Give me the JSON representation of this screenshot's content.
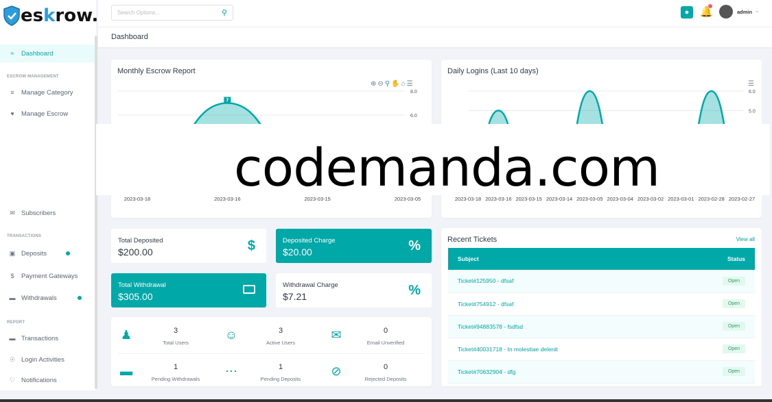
{
  "brand": {
    "pre": "es",
    "mid": "k",
    "post": "row."
  },
  "search": {
    "placeholder": "Search Options..."
  },
  "user": {
    "name": "admin"
  },
  "breadcrumb": "Dashboard",
  "sidebar": {
    "items": [
      {
        "label": "Dashboard",
        "icon": "chart-icon",
        "active": true
      },
      {
        "section": "ESCROW MANAGEMENT"
      },
      {
        "label": "Manage Category",
        "icon": "list-icon"
      },
      {
        "label": "Manage Escrow",
        "icon": "handshake-icon"
      },
      {
        "label": "Subscribers",
        "icon": "mail-icon"
      },
      {
        "section": "TRANSACTIONS"
      },
      {
        "label": "Deposits",
        "icon": "wallet-icon",
        "dot": true
      },
      {
        "label": "Payment Gateways",
        "icon": "dollar-icon"
      },
      {
        "label": "Withdrawals",
        "icon": "card-icon",
        "dot": true
      },
      {
        "section": "REPORT"
      },
      {
        "label": "Transactions",
        "icon": "card-icon"
      },
      {
        "label": "Login Activities",
        "icon": "login-icon"
      },
      {
        "label": "Notifications",
        "icon": "bell-icon"
      }
    ]
  },
  "chart_data": [
    {
      "type": "area",
      "title": "Monthly Escrow Report",
      "categories": [
        "2023-03-18",
        "2023-03-16",
        "2023-03-15",
        "2023-03-05"
      ],
      "values": [
        0,
        7,
        0,
        0
      ],
      "data_labels": [
        "7"
      ],
      "ylim": [
        0,
        8
      ],
      "yticks": [
        "8.0",
        "6.0"
      ],
      "grid": true,
      "color": "#00a9a8"
    },
    {
      "type": "area",
      "title": "Daily Logins (Last 10 days)",
      "categories": [
        "2023-03-18",
        "2023-03-16",
        "2023-03-15",
        "2023-03-14",
        "2023-03-05",
        "2023-03-04",
        "2023-03-02",
        "2023-03-01",
        "2023-02-28",
        "2023-02-27"
      ],
      "values": [
        1,
        5,
        1,
        1,
        6,
        1,
        1,
        1,
        6,
        1
      ],
      "ylim": [
        1,
        6
      ],
      "yticks": [
        "6.0",
        "5.0"
      ],
      "grid": true,
      "color": "#00a9a8"
    }
  ],
  "stats": [
    {
      "label": "Total Deposited",
      "value": "$200.00",
      "icon": "hand-dollar-icon"
    },
    {
      "label": "Deposited Charge",
      "value": "$20.00",
      "icon": "percent-icon"
    },
    {
      "label": "Total Withdrawal",
      "value": "$305.00",
      "icon": "card-icon"
    },
    {
      "label": "Withdrawal Charge",
      "value": "$7.21",
      "icon": "percent-icon"
    }
  ],
  "counts": [
    {
      "n": "3",
      "label": "Total Users",
      "icon": "users-icon"
    },
    {
      "n": "3",
      "label": "Active Users",
      "icon": "user-check-icon"
    },
    {
      "n": "0",
      "label": "Email Unverified",
      "icon": "envelope-icon"
    },
    {
      "n": "1",
      "label": "Pending Withdrawals",
      "icon": "card-icon"
    },
    {
      "n": "1",
      "label": "Pending Deposits",
      "icon": "spinner-icon"
    },
    {
      "n": "0",
      "label": "Rejected Deposits",
      "icon": "ban-icon"
    }
  ],
  "tickets": {
    "title": "Recent Tickets",
    "view_all": "View all",
    "headers": [
      "Subject",
      "Status"
    ],
    "rows": [
      {
        "subject": "Ticket#125950 - dfsaf",
        "status": "Open"
      },
      {
        "subject": "Ticket#754912 - dfsaf",
        "status": "Open"
      },
      {
        "subject": "Ticket#94883578 - fsdfsd",
        "status": "Open"
      },
      {
        "subject": "Ticket#40031718 - In molestiae delenit",
        "status": "Open"
      },
      {
        "subject": "Ticket#70632904 - dfg",
        "status": "Open"
      }
    ]
  },
  "watermark": "codemanda.com"
}
